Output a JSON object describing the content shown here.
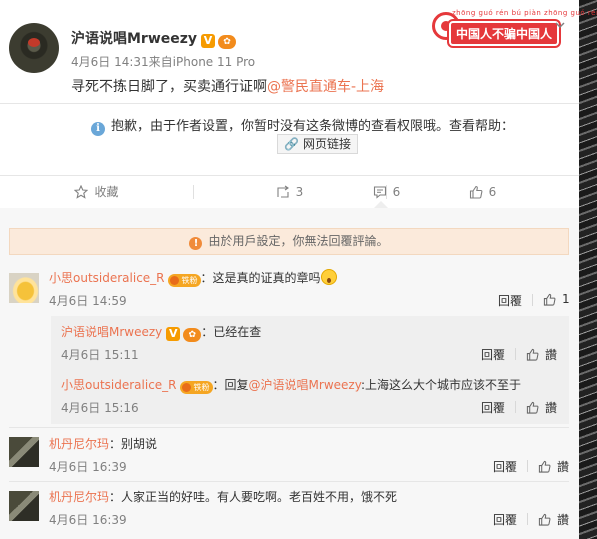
{
  "post": {
    "author": "沪语说唱Mrweezy",
    "verified_badge": "V",
    "time": "4月6日 14:31",
    "source": "来自iPhone 11 Pro",
    "text_prefix": "寻死不拣日脚了，买卖通行证啊",
    "mention": "@警民直通车-上海"
  },
  "decor": {
    "banner_text": "中国人不骗中国人",
    "pinyin": "zhōng guó rén bú piàn zhōng guó rén"
  },
  "notice": {
    "text": "抱歉，由于作者设置，你暂时没有这条微博的查看权限哦。查看帮助：",
    "link_label": "网页链接"
  },
  "actions": {
    "favorite": "收藏",
    "repost_count": "3",
    "comment_count": "6",
    "like_count": "6"
  },
  "comment_notice": "由於用戶設定，你無法回覆評論。",
  "comments": [
    {
      "user": "小思outsideralice_R",
      "fan_label": "铁粉",
      "text": "：这是真的证真的章吗",
      "time": "4月6日 14:59",
      "reply": "回覆",
      "likes": "1"
    },
    {
      "user": "机丹尼尔玛",
      "text": "：别胡说",
      "time": "4月6日 16:39",
      "reply": "回覆",
      "like_label": "讚"
    },
    {
      "user": "机丹尼尔玛",
      "text": "：人家正当的好哇。有人要吃啊。老百姓不用，饿不死",
      "time": "4月6日 16:39",
      "reply": "回覆",
      "like_label": "讚"
    }
  ],
  "sub_replies": [
    {
      "user": "沪语说唱Mrweezy",
      "verified_badge": "V",
      "text": "：已经在查",
      "time": "4月6日 15:11",
      "reply": "回覆",
      "like_label": "讚"
    },
    {
      "user": "小思outsideralice_R",
      "fan_label": "铁粉",
      "prefix": "：回复",
      "mention": "@沪语说唱Mrweezy",
      "text": ":上海这么大个城市应该不至于",
      "time": "4月6日 15:16",
      "reply": "回覆",
      "like_label": "讚"
    }
  ]
}
